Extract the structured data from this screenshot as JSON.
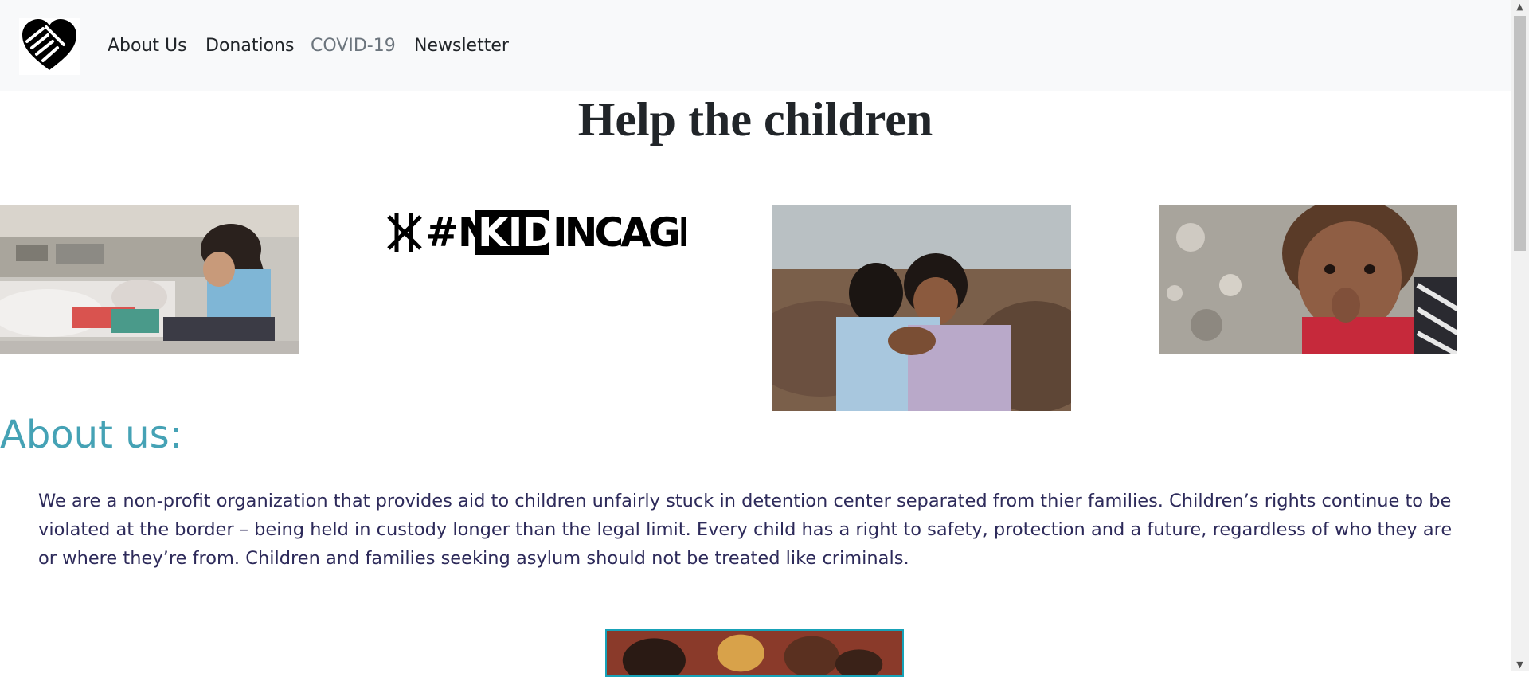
{
  "nav": {
    "logo_icon": "heart-handshake-icon",
    "items": [
      {
        "label": "About Us",
        "active": false
      },
      {
        "label": "Donations",
        "active": false
      },
      {
        "label": "COVID-19",
        "active": true
      },
      {
        "label": "Newsletter",
        "active": false
      }
    ]
  },
  "main": {
    "title": "Help the children",
    "banner_text": {
      "part1": "#NO",
      "part2": "KIDS",
      "part3": "INCAGES"
    }
  },
  "about": {
    "heading": "About us:",
    "text": "We are a non-profit organization that provides aid to children unfairly stuck in detention center separated from thier families. Children’s rights continue to be violated at the border – being held in custody longer than the legal limit. Every child has a right to safety, protection and a future, regardless of who they are or where they’re from. Children and families seeking asylum should not be treated like criminals."
  },
  "colors": {
    "accent": "#45a2b5",
    "nav_bg": "#f8f9fa",
    "text": "#2d2a5a"
  }
}
